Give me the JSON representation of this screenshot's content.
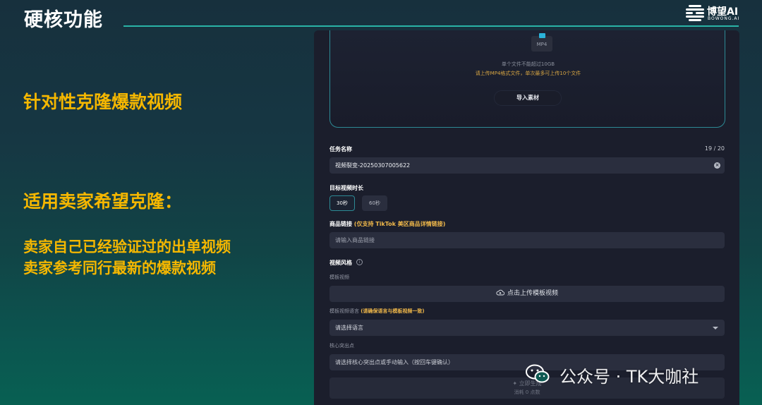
{
  "slide": {
    "title": "硬核功能",
    "logo_name": "博望AI",
    "logo_sub": "BOWONG.AI",
    "headline": "针对性克隆爆款视频",
    "subheadline": "适用卖家希望克隆：",
    "bullets": [
      "卖家自己已经验证过的出单视频",
      "卖家参考同行最新的爆款视频"
    ]
  },
  "app": {
    "upload": {
      "file_type": "MP4",
      "size_limit": "单个文件不能超过10GB",
      "format_hint": "请上传MP4格式文件，单次最多可上传10个文件",
      "import_button": "导入素材"
    },
    "task_name": {
      "label": "任务名称",
      "counter": "19 / 20",
      "value": "视频裂变-20250307005622"
    },
    "duration": {
      "label": "目标视频时长",
      "options": [
        "30秒",
        "60秒"
      ],
      "selected": "30秒"
    },
    "product_link": {
      "label": "商品链接",
      "note": "(仅支持 TikTok 美区商品详情链接)",
      "placeholder": "请输入商品链接"
    },
    "style": {
      "label": "视频风格",
      "template_label": "模板视频",
      "upload_button": "点击上传模板视频",
      "language_label": "模板视频语言",
      "language_note": "(请确保语言与模板视频一致)",
      "language_placeholder": "请选择语言",
      "highlight_label": "核心突出点",
      "highlight_placeholder": "请选择核心突出点或手动输入（按回车键确认）"
    },
    "submit": {
      "label": "立即生成",
      "cost": "消耗 0 点数"
    }
  },
  "watermark": {
    "text": "公众号 · TK大咖社"
  },
  "colors": {
    "accent_yellow": "#f5b700",
    "teal_line": "#2ab3a6",
    "panel_bg": "#1b1e2c",
    "field_bg": "#2a2e3e",
    "note_orange": "#f0b84a"
  }
}
